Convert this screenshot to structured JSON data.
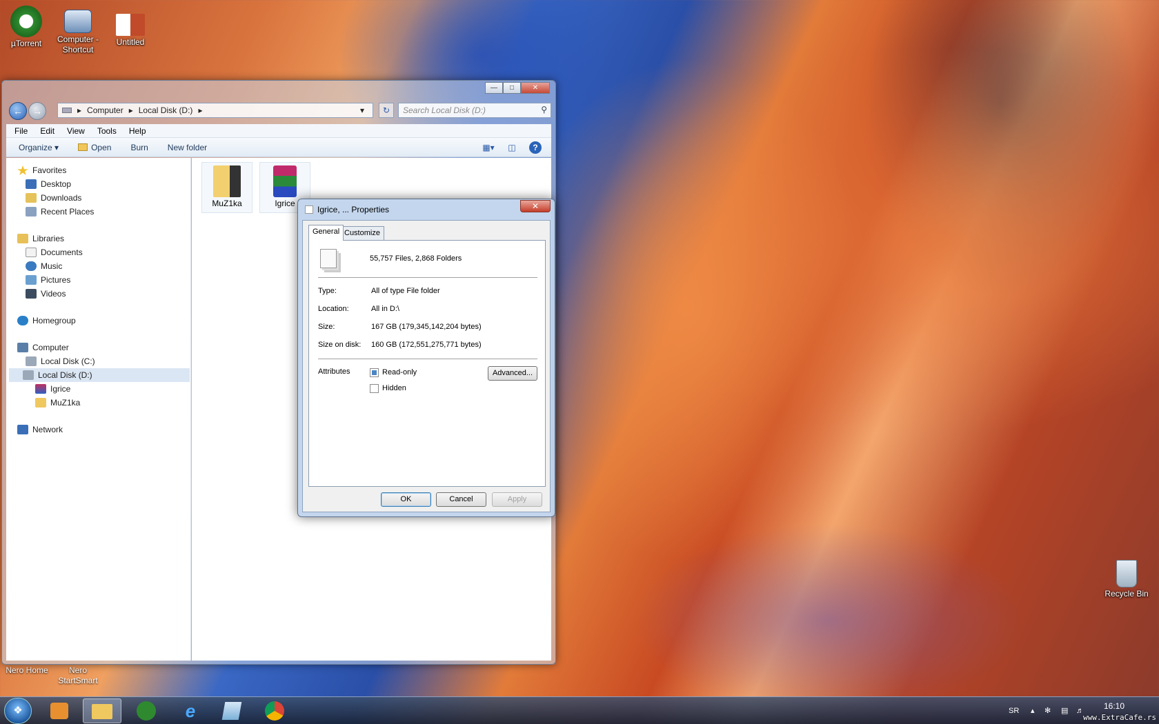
{
  "desktop": {
    "icons": [
      {
        "label": "µTorrent"
      },
      {
        "label": "Computer - Shortcut"
      },
      {
        "label": "Untitled"
      },
      {
        "label": "Recycle Bin"
      }
    ],
    "bottom_labels": [
      "Nero Home",
      "Nero StartSmart"
    ]
  },
  "explorer": {
    "breadcrumb": [
      "Computer",
      "Local Disk (D:)"
    ],
    "search_placeholder": "Search Local Disk (D:)",
    "menu": [
      "File",
      "Edit",
      "View",
      "Tools",
      "Help"
    ],
    "toolbar": {
      "organize": "Organize",
      "open": "Open",
      "burn": "Burn",
      "new_folder": "New folder"
    },
    "nav": {
      "favorites": "Favorites",
      "desktop": "Desktop",
      "downloads": "Downloads",
      "recent": "Recent Places",
      "libraries": "Libraries",
      "documents": "Documents",
      "music": "Music",
      "pictures": "Pictures",
      "videos": "Videos",
      "homegroup": "Homegroup",
      "computer": "Computer",
      "disk_c": "Local Disk (C:)",
      "disk_d": "Local Disk (D:)",
      "igrice": "Igrice",
      "muz1ka": "MuZ1ka",
      "network": "Network"
    },
    "items": [
      {
        "label": "MuZ1ka"
      },
      {
        "label": "Igrice"
      }
    ]
  },
  "dialog": {
    "title": "Igrice, ... Properties",
    "tabs": [
      "General",
      "Customize"
    ],
    "summary": "55,757 Files, 2,868 Folders",
    "rows": [
      {
        "label": "Type:",
        "value": "All of type File folder"
      },
      {
        "label": "Location:",
        "value": "All in D:\\"
      },
      {
        "label": "Size:",
        "value": "167 GB (179,345,142,204 bytes)"
      },
      {
        "label": "Size on disk:",
        "value": "160 GB (172,551,275,771 bytes)"
      }
    ],
    "attributes_label": "Attributes",
    "read_only": "Read-only",
    "hidden": "Hidden",
    "advanced": "Advanced...",
    "ok": "OK",
    "cancel": "Cancel",
    "apply": "Apply"
  },
  "taskbar": {
    "lang": "SR",
    "time": "16:10"
  },
  "watermark": "www.ExtraCafe.rs",
  "colors": {
    "accent": "#2a64b8",
    "close": "#c53e2a"
  }
}
